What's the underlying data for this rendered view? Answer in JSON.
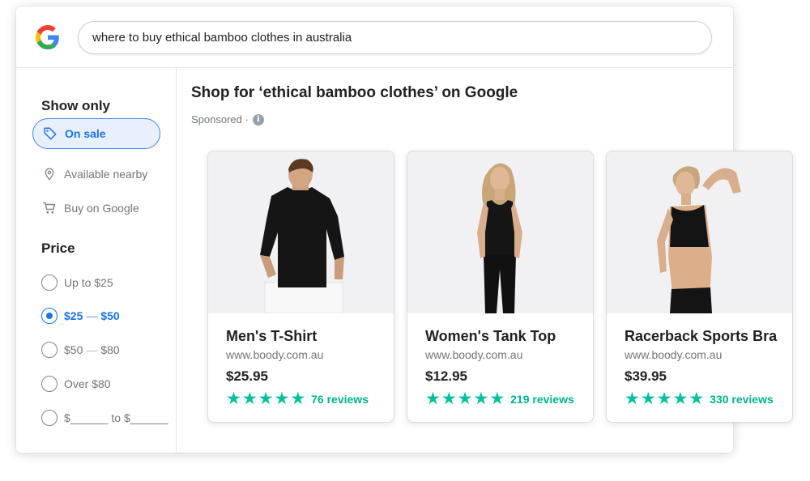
{
  "search": {
    "query": "where to buy ethical bamboo clothes in australia"
  },
  "sidebar": {
    "show_only_heading": "Show only",
    "filters": [
      {
        "label": "On sale",
        "icon": "tag-icon",
        "selected": true
      },
      {
        "label": "Available nearby",
        "icon": "location-pin-icon",
        "selected": false
      },
      {
        "label": "Buy on Google",
        "icon": "cart-icon",
        "selected": false
      }
    ],
    "price_heading": "Price",
    "price_options": [
      {
        "label": "Up to $25",
        "selected": false
      },
      {
        "from": "$25",
        "to": "$50",
        "selected": true
      },
      {
        "from": "$50",
        "to": "$80",
        "selected": false
      },
      {
        "label": "Over $80",
        "selected": false
      },
      {
        "custom": "$______ to $______",
        "selected": false
      }
    ]
  },
  "main": {
    "title": "Shop for ‘ethical bamboo clothes’ on Google",
    "sponsored": "Sponsored ·"
  },
  "products": [
    {
      "name": "Men's T-Shirt",
      "site": "www.boody.com.au",
      "price": "$25.95",
      "stars": 5,
      "reviews": "76 reviews"
    },
    {
      "name": "Women's Tank Top",
      "site": "www.boody.com.au",
      "price": "$12.95",
      "stars": 5,
      "reviews": "219 reviews"
    },
    {
      "name": "Racerback Sports Bra",
      "site": "www.boody.com.au",
      "price": "$39.95",
      "stars": 5,
      "reviews": "330 reviews"
    }
  ],
  "colors": {
    "accent_blue": "#1a73e8",
    "star_green": "#00c29a",
    "pill_bg": "#e8f0fe"
  }
}
